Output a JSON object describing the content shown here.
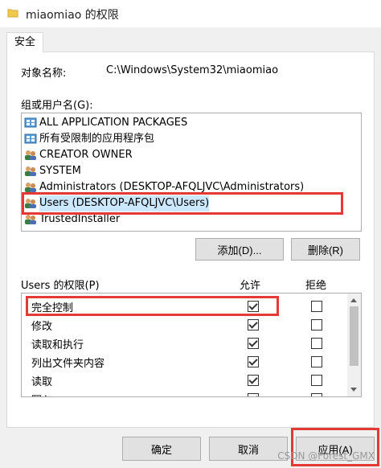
{
  "window": {
    "title": "miaomiao 的权限"
  },
  "tabs": [
    {
      "label": "安全"
    }
  ],
  "object": {
    "label": "对象名称:",
    "value": "C:\\Windows\\System32\\miaomiao"
  },
  "groups": {
    "label": "组或用户名(G):",
    "items": [
      {
        "label": "ALL APPLICATION PACKAGES",
        "icon": "app-packages-icon"
      },
      {
        "label": "所有受限制的应用程序包",
        "icon": "app-packages-icon"
      },
      {
        "label": "CREATOR OWNER",
        "icon": "users-icon"
      },
      {
        "label": "SYSTEM",
        "icon": "users-icon"
      },
      {
        "label": "Administrators (DESKTOP-AFQLJVC\\Administrators)",
        "icon": "users-icon"
      },
      {
        "label": "Users (DESKTOP-AFQLJVC\\Users)",
        "icon": "users-icon",
        "selected": true
      },
      {
        "label": "TrustedInstaller",
        "icon": "users-icon"
      }
    ]
  },
  "buttons": {
    "add": "添加(D)...",
    "remove": "删除(R)",
    "ok": "确定",
    "cancel": "取消",
    "apply": "应用(A)"
  },
  "permissions": {
    "label": "Users 的权限(P)",
    "allow_header": "允许",
    "deny_header": "拒绝",
    "rows": [
      {
        "name": "完全控制",
        "allow": true,
        "deny": false
      },
      {
        "name": "修改",
        "allow": true,
        "deny": false
      },
      {
        "name": "读取和执行",
        "allow": true,
        "deny": false
      },
      {
        "name": "列出文件夹内容",
        "allow": true,
        "deny": false
      },
      {
        "name": "读取",
        "allow": true,
        "deny": false
      },
      {
        "name": "写入",
        "allow": true,
        "deny": false
      }
    ]
  },
  "watermark": "CSDN @Forest_GMX",
  "colors": {
    "highlight_box": "#e53935",
    "selection": "#cce8ff",
    "dialog_bg": "#f0f0f0"
  }
}
